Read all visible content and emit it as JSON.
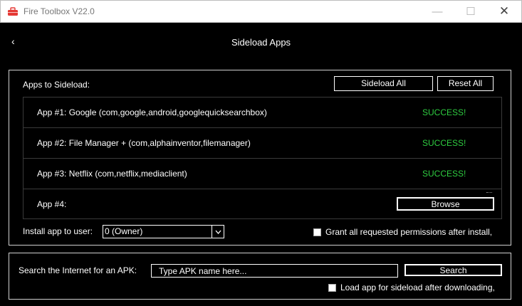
{
  "window": {
    "title": "Fire Toolbox V22.0",
    "minimize_glyph": "—",
    "maximize_glyph": "☐",
    "close_glyph": "✕",
    "icon": "toolbox-icon",
    "accent_color": "#e53935"
  },
  "header": {
    "back_glyph": "‹",
    "title": "Sideload Apps"
  },
  "sideload": {
    "section_label": "Apps to Sideload:",
    "sideload_all_label": "Sideload All",
    "reset_all_label": "Reset All",
    "apps": [
      {
        "label": "App #1: Google (com,google,android,googlequicksearchbox)",
        "status": "SUCCESS!"
      },
      {
        "label": "App #2: File Manager + (com,alphainventor,filemanager)",
        "status": "SUCCESS!"
      },
      {
        "label": "App #3: Netflix (com,netflix,mediaclient)",
        "status": "SUCCESS!"
      },
      {
        "label": "App #4:",
        "browse_label": "Browse"
      }
    ],
    "status_color": "#2ecc40",
    "install_user_label": "Install app to user:",
    "install_user_value": "0 (Owner)",
    "grant_permissions_label": "Grant all requested permissions after install,"
  },
  "search": {
    "label": "Search the Internet for an APK:",
    "placeholder": "Type APK name here...",
    "value": "",
    "button_label": "Search",
    "load_after_download_label": "Load app for sideload after downloading,"
  }
}
